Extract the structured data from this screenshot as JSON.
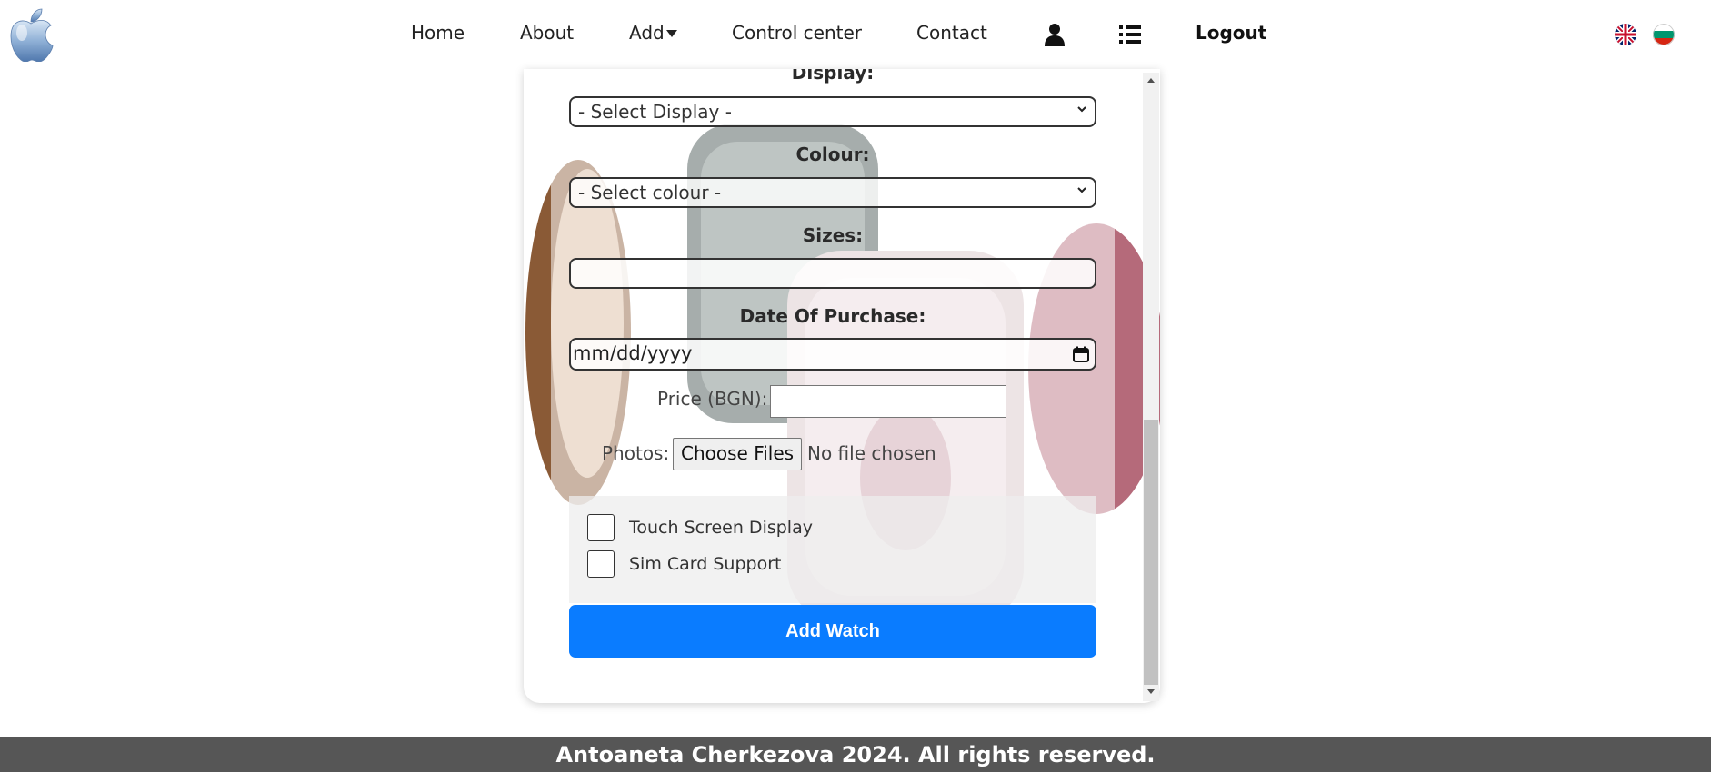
{
  "navbar": {
    "logo_label": "Apple logo",
    "links": {
      "home": "Home",
      "about": "About",
      "add": "Add",
      "control_center": "Control center",
      "contact": "Contact",
      "logout": "Logout"
    },
    "icons": {
      "profile": "user-icon",
      "list": "list-icon"
    },
    "languages": [
      "English",
      "Bulgarian"
    ]
  },
  "form": {
    "display_label": "Display:",
    "display_select": "- Select Display -",
    "colour_label": "Colour:",
    "colour_select": "- Select colour -",
    "sizes_label": "Sizes:",
    "sizes_value": "",
    "date_label": "Date Of Purchase:",
    "date_placeholder": "mm/dd/yyyy",
    "price_label": "Price (BGN):",
    "price_value": "",
    "photos_label": "Photos:",
    "photos_button": "Choose Files",
    "photos_status": "No file chosen",
    "checkboxes": [
      {
        "label": "Touch Screen Display",
        "checked": false
      },
      {
        "label": "Sim Card Support",
        "checked": false
      }
    ],
    "submit_label": "Add Watch"
  },
  "footer": {
    "text": "Antoaneta Cherkezova 2024. All rights reserved."
  },
  "colors": {
    "accent": "#0a7cff",
    "footer_bg": "#565656"
  }
}
